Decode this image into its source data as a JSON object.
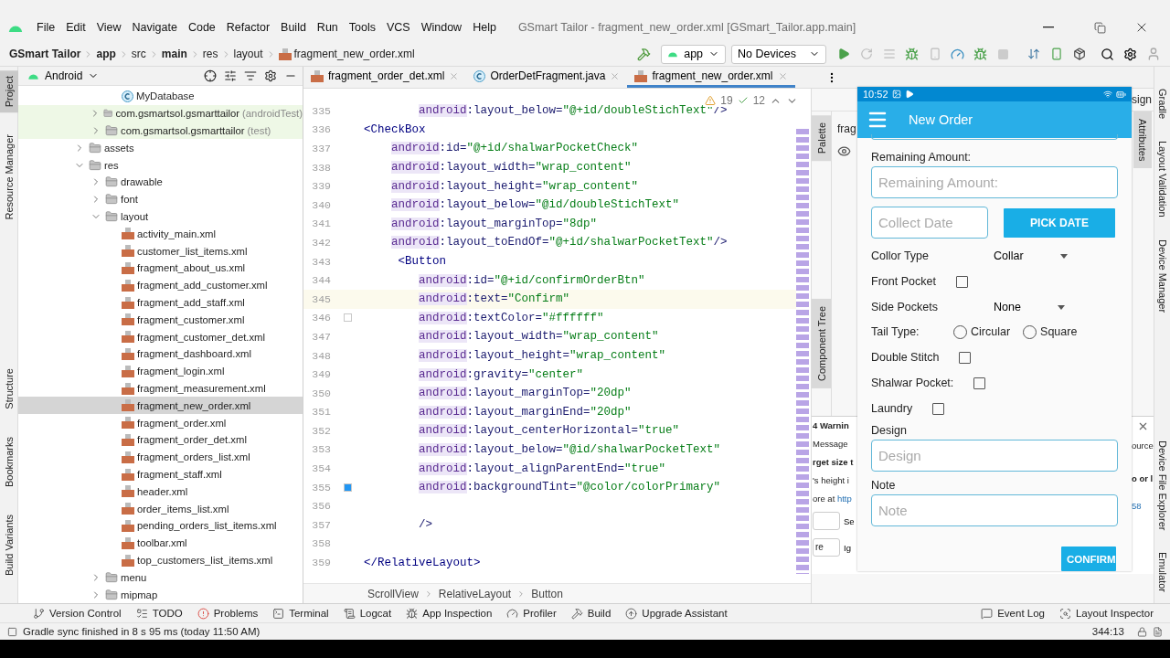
{
  "menu_bar": {
    "items": [
      "File",
      "Edit",
      "View",
      "Navigate",
      "Code",
      "Refactor",
      "Build",
      "Run",
      "Tools",
      "VCS",
      "Window",
      "Help"
    ],
    "title": "GSmart Tailor - fragment_new_order.xml [GSmart_Tailor.app.main]"
  },
  "breadcrumbs": [
    {
      "text": "GSmart Tailor",
      "bold": true,
      "kind": "dir"
    },
    {
      "text": "app",
      "bold": true,
      "kind": "dir"
    },
    {
      "text": "src",
      "bold": false,
      "kind": "dir"
    },
    {
      "text": "main",
      "bold": true,
      "kind": "dir"
    },
    {
      "text": "res",
      "bold": false,
      "kind": "dir"
    },
    {
      "text": "layout",
      "bold": false,
      "kind": "dir"
    },
    {
      "text": "fragment_new_order.xml",
      "bold": false,
      "kind": "file"
    }
  ],
  "toolbar": {
    "config": "app",
    "device": "No Devices"
  },
  "left_tool_tabs": [
    {
      "label": "Project",
      "selected": true
    },
    {
      "label": "Resource Manager",
      "selected": false
    },
    {
      "label": "Structure",
      "selected": false
    },
    {
      "label": "Bookmarks",
      "selected": false
    },
    {
      "label": "Build Variants",
      "selected": false
    }
  ],
  "project_panel": {
    "view": "Android",
    "tree": [
      {
        "children": [
          {
            "children": [
              {
                "label": "MyDatabase",
                "kind": "class",
                "selected": false
              }
            ]
          },
          {
            "label": "com.gsmartsol.gsmarttailor",
            "note": "(androidTest)",
            "kind": "test-package",
            "expanded": false,
            "selected": false
          },
          {
            "label": "com.gsmartsol.gsmarttailor",
            "note": "(test)",
            "kind": "test-package",
            "expanded": false,
            "selected": false
          }
        ]
      },
      {
        "label": "assets",
        "kind": "folder",
        "expanded": false,
        "selected": false
      },
      {
        "label": "res",
        "kind": "folder",
        "expanded": true,
        "selected": false,
        "children": [
          {
            "label": "drawable",
            "kind": "folder",
            "expanded": false,
            "selected": false
          },
          {
            "label": "font",
            "kind": "folder",
            "expanded": false,
            "selected": false
          },
          {
            "label": "layout",
            "kind": "folder",
            "expanded": true,
            "selected": false,
            "children": [
              {
                "label": "activity_main.xml",
                "kind": "file",
                "selected": false
              },
              {
                "label": "customer_list_items.xml",
                "kind": "file",
                "selected": false
              },
              {
                "label": "fragment_about_us.xml",
                "kind": "file",
                "selected": false
              },
              {
                "label": "fragment_add_customer.xml",
                "kind": "file",
                "selected": false
              },
              {
                "label": "fragment_add_staff.xml",
                "kind": "file",
                "selected": false
              },
              {
                "label": "fragment_customer.xml",
                "kind": "file",
                "selected": false
              },
              {
                "label": "fragment_customer_det.xml",
                "kind": "file",
                "selected": false
              },
              {
                "label": "fragment_dashboard.xml",
                "kind": "file",
                "selected": false
              },
              {
                "label": "fragment_login.xml",
                "kind": "file",
                "selected": false
              },
              {
                "label": "fragment_measurement.xml",
                "kind": "file",
                "selected": false
              },
              {
                "label": "fragment_new_order.xml",
                "kind": "file",
                "selected": true
              },
              {
                "label": "fragment_order.xml",
                "kind": "file",
                "selected": false
              },
              {
                "label": "fragment_order_det.xml",
                "kind": "file",
                "selected": false
              },
              {
                "label": "fragment_orders_list.xml",
                "kind": "file",
                "selected": false
              },
              {
                "label": "fragment_staff.xml",
                "kind": "file",
                "selected": false
              },
              {
                "label": "header.xml",
                "kind": "file",
                "selected": false
              },
              {
                "label": "order_items_list.xml",
                "kind": "file",
                "selected": false
              },
              {
                "label": "pending_orders_list_items.xml",
                "kind": "file",
                "selected": false
              },
              {
                "label": "toolbar.xml",
                "kind": "file",
                "selected": false
              },
              {
                "label": "top_customers_list_items.xml",
                "kind": "file",
                "selected": false
              }
            ]
          },
          {
            "label": "menu",
            "kind": "folder",
            "expanded": false,
            "selected": false
          },
          {
            "label": "mipmap",
            "kind": "folder",
            "expanded": false,
            "selected": false
          }
        ]
      }
    ]
  },
  "editor": {
    "tabs": [
      {
        "label": "fragment_order_det.xml",
        "kind": "xml",
        "selected": false
      },
      {
        "label": "OrderDetFragment.java",
        "kind": "java",
        "selected": false
      },
      {
        "label": "fragment_new_order.xml",
        "kind": "xml",
        "selected": true
      }
    ],
    "inspections": {
      "warnings": "19",
      "weak_warnings": "12"
    },
    "lines": [
      {
        "number": "335",
        "text": "        android:layout_below=\"@+id/doubleStichText\"/>",
        "selected": false
      },
      {
        "number": "336",
        "text": "<CheckBox",
        "selected": false
      },
      {
        "number": "337",
        "text": "    android:id=\"@+id/shalwarPocketCheck\"",
        "selected": false
      },
      {
        "number": "338",
        "text": "    android:layout_width=\"wrap_content\"",
        "selected": false
      },
      {
        "number": "339",
        "text": "    android:layout_height=\"wrap_content\"",
        "selected": false
      },
      {
        "number": "340",
        "text": "    android:layout_below=\"@id/doubleStichText\"",
        "selected": false
      },
      {
        "number": "341",
        "text": "    android:layout_marginTop=\"8dp\"",
        "selected": false
      },
      {
        "number": "342",
        "text": "    android:layout_toEndOf=\"@+id/shalwarPocketText\"/>",
        "selected": false
      },
      {
        "number": "343",
        "text": "     <Button",
        "selected": false
      },
      {
        "number": "344",
        "text": "        android:id=\"@+id/confirmOrderBtn\"",
        "selected": false
      },
      {
        "number": "345",
        "text": "        android:text=\"Confirm\"",
        "selected": true
      },
      {
        "number": "346",
        "text": "        android:textColor=\"#ffffff\"",
        "selected": false,
        "color": "#ffffff"
      },
      {
        "number": "347",
        "text": "        android:layout_width=\"wrap_content\"",
        "selected": false
      },
      {
        "number": "348",
        "text": "        android:layout_height=\"wrap_content\"",
        "selected": false
      },
      {
        "number": "349",
        "text": "        android:gravity=\"center\"",
        "selected": false
      },
      {
        "number": "350",
        "text": "        android:layout_marginTop=\"20dp\"",
        "selected": false
      },
      {
        "number": "351",
        "text": "        android:layout_marginEnd=\"20dp\"",
        "selected": false
      },
      {
        "number": "352",
        "text": "        android:layout_centerHorizontal=\"true\"",
        "selected": false
      },
      {
        "number": "353",
        "text": "        android:layout_below=\"@id/shalwarPocketText\"",
        "selected": false
      },
      {
        "number": "354",
        "text": "        android:layout_alignParentEnd=\"true\"",
        "selected": false
      },
      {
        "number": "355",
        "text": "        android:backgroundTint=\"@color/colorPrimary\"",
        "selected": false,
        "color": "#2196f3"
      },
      {
        "number": "356",
        "selected": false
      },
      {
        "number": "357",
        "text": "        />",
        "selected": false
      },
      {
        "number": "358",
        "selected": false
      },
      {
        "number": "359",
        "text": "</RelativeLayout>",
        "selected": false
      }
    ],
    "path": [
      "ScrollView",
      "RelativeLayout",
      "Button"
    ]
  },
  "design_panel": {
    "mode_tab": "sign",
    "file_tab": "frag",
    "side_tabs": [
      "Palette",
      "Component Tree"
    ],
    "attributes_tab": "Attributes",
    "problems": {
      "title": "4 Warnin",
      "column_1": "Message",
      "column_2": "ource",
      "left_lines": [
        "rget size t",
        "'s height i"
      ],
      "link_prefix": "ore at ",
      "link": "http",
      "right_lines": [
        "o or l"
      ],
      "right_link": "58",
      "field_text": "re",
      "buttons": [
        "Se",
        "Ig"
      ]
    }
  },
  "emulator": {
    "time": "10:52",
    "title": "New Order",
    "form": [
      {
        "kind": "label",
        "text": "Remaining Amount:"
      },
      {
        "kind": "input",
        "placeholder": "Remaining Amount:"
      },
      {
        "kind": "date",
        "placeholder": "Collect Date",
        "button": "PICK DATE"
      },
      {
        "kind": "dropdown",
        "label": "Collor Type",
        "value": "Collar"
      },
      {
        "kind": "checkbox",
        "label": "Front Pocket",
        "checked": false
      },
      {
        "kind": "dropdown",
        "label": "Side Pockets",
        "value": "None"
      },
      {
        "kind": "radio",
        "label": "Tail Type:",
        "options": [
          {
            "label": "Circular",
            "selected": false
          },
          {
            "label": "Square",
            "selected": false
          }
        ]
      },
      {
        "kind": "checkbox",
        "label": "Double Stitch",
        "checked": false
      },
      {
        "kind": "checkbox",
        "label": "Shalwar Pocket:",
        "checked": false
      },
      {
        "kind": "checkbox",
        "label": "Laundry",
        "checked": false
      },
      {
        "kind": "label",
        "text": "Design"
      },
      {
        "kind": "input",
        "placeholder": "Design"
      },
      {
        "kind": "label",
        "text": "Note"
      },
      {
        "kind": "input",
        "placeholder": "Note"
      },
      {
        "kind": "button",
        "text": "CONFIRM"
      }
    ]
  },
  "right_tool_tabs": [
    "Gradle",
    "Layout Validation",
    "Device Manager",
    "Device File Explorer",
    "Emulator"
  ],
  "bottom_tool_tabs": {
    "left": [
      {
        "label": "Version Control",
        "kind": "vcs"
      },
      {
        "label": "TODO",
        "kind": "todo"
      },
      {
        "label": "Problems",
        "kind": "problems"
      },
      {
        "label": "Terminal",
        "kind": "terminal"
      },
      {
        "label": "Logcat",
        "kind": "logcat"
      },
      {
        "label": "App Inspection",
        "kind": "inspection"
      },
      {
        "label": "Profiler",
        "kind": "profiler"
      },
      {
        "label": "Build",
        "kind": "build"
      },
      {
        "label": "Upgrade Assistant",
        "kind": "upgrade"
      }
    ],
    "right": [
      {
        "label": "Event Log",
        "kind": "log"
      },
      {
        "label": "Layout Inspector",
        "kind": "inspector"
      }
    ]
  },
  "status_bar": {
    "message": "Gradle sync finished in 8 s 95 ms (today 11:50 AM)",
    "position": "344:13"
  }
}
